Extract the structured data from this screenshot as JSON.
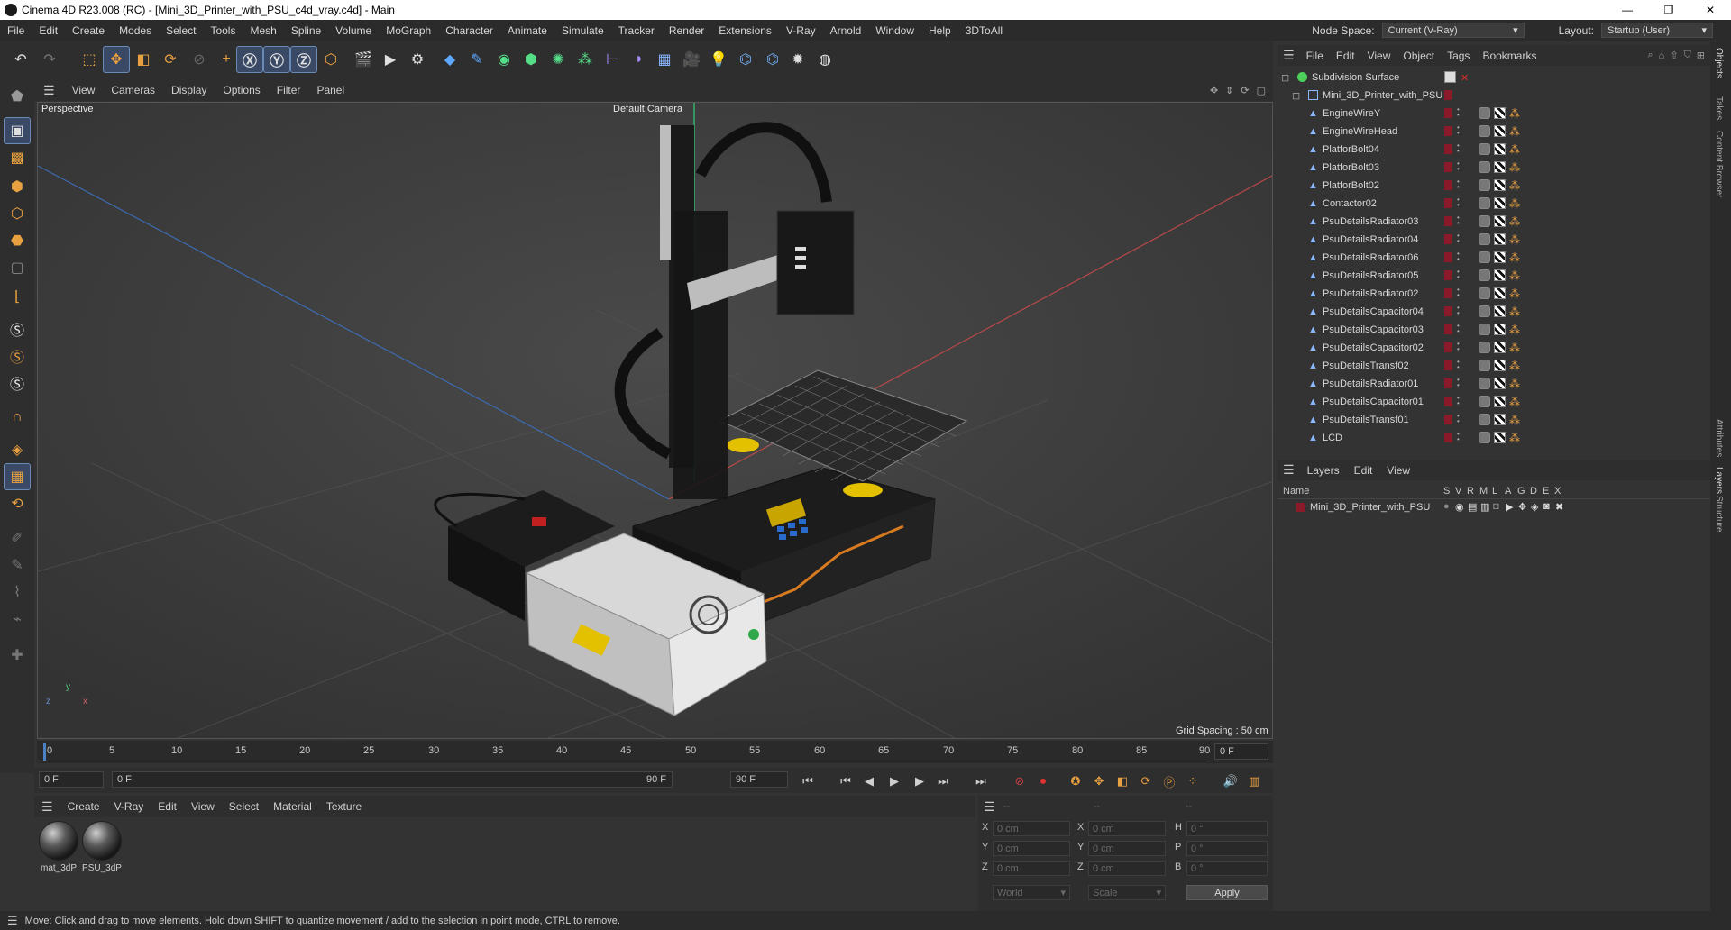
{
  "window": {
    "title": "Cinema 4D R23.008 (RC) - [Mini_3D_Printer_with_PSU_c4d_vray.c4d] - Main",
    "minimize": "—",
    "maximize": "❐",
    "close": "✕"
  },
  "menu": {
    "items": [
      "File",
      "Edit",
      "Create",
      "Modes",
      "Select",
      "Tools",
      "Mesh",
      "Spline",
      "Volume",
      "MoGraph",
      "Character",
      "Animate",
      "Simulate",
      "Tracker",
      "Render",
      "Extensions",
      "V-Ray",
      "Arnold",
      "Window",
      "Help",
      "3DToAll"
    ],
    "node_space_label": "Node Space:",
    "node_space_value": "Current (V-Ray)",
    "layout_label": "Layout:",
    "layout_value": "Startup (User)"
  },
  "viewport": {
    "menu": [
      "View",
      "Cameras",
      "Display",
      "Options",
      "Filter",
      "Panel"
    ],
    "view_name": "Perspective",
    "camera": "Default Camera",
    "grid_spacing": "Grid Spacing : 50 cm",
    "axis_y": "y",
    "axis_x": "x",
    "axis_z": "z"
  },
  "timeline": {
    "ticks": [
      "0",
      "5",
      "10",
      "15",
      "20",
      "25",
      "30",
      "35",
      "40",
      "45",
      "50",
      "55",
      "60",
      "65",
      "70",
      "75",
      "80",
      "85",
      "90"
    ],
    "current_frame": "0 F",
    "start_field": "0 F",
    "range_start": "0 F",
    "range_end": "90 F",
    "end_field": "90 F"
  },
  "materials": {
    "menu": [
      "Create",
      "V-Ray",
      "Edit",
      "View",
      "Select",
      "Material",
      "Texture"
    ],
    "items": [
      {
        "name": "mat_3dP"
      },
      {
        "name": "PSU_3dP"
      }
    ]
  },
  "coordinates": {
    "header_dashes": [
      "--",
      "--",
      "--"
    ],
    "rows": [
      {
        "a": "X",
        "av": "0 cm",
        "b": "X",
        "bv": "0 cm",
        "c": "H",
        "cv": "0 °"
      },
      {
        "a": "Y",
        "av": "0 cm",
        "b": "Y",
        "bv": "0 cm",
        "c": "P",
        "cv": "0 °"
      },
      {
        "a": "Z",
        "av": "0 cm",
        "b": "Z",
        "bv": "0 cm",
        "c": "B",
        "cv": "0 °"
      }
    ],
    "mode1": "World",
    "mode2": "Scale",
    "apply": "Apply"
  },
  "status": "Move: Click and drag to move elements. Hold down SHIFT to quantize movement / add to the selection in point mode, CTRL to remove.",
  "objects": {
    "menu": [
      "File",
      "Edit",
      "View",
      "Object",
      "Tags",
      "Bookmarks"
    ],
    "root": "Subdivision Surface",
    "group": "Mini_3D_Printer_with_PSU",
    "children": [
      "EngineWireY",
      "EngineWireHead",
      "PlatforBolt04",
      "PlatforBolt03",
      "PlatforBolt02",
      "Contactor02",
      "PsuDetailsRadiator03",
      "PsuDetailsRadiator04",
      "PsuDetailsRadiator06",
      "PsuDetailsRadiator05",
      "PsuDetailsRadiator02",
      "PsuDetailsCapacitor04",
      "PsuDetailsCapacitor03",
      "PsuDetailsCapacitor02",
      "PsuDetailsTransf02",
      "PsuDetailsRadiator01",
      "PsuDetailsCapacitor01",
      "PsuDetailsTransf01",
      "LCD"
    ]
  },
  "layers": {
    "menu": [
      "Layers",
      "Edit",
      "View"
    ],
    "columns": [
      "Name",
      "S",
      "V",
      "R",
      "M",
      "L",
      "A",
      "G",
      "D",
      "E",
      "X"
    ],
    "rows": [
      {
        "name": "Mini_3D_Printer_with_PSU"
      }
    ]
  },
  "side_tabs": [
    "Objects",
    "Takes",
    "Content Browser",
    "Attributes",
    "Layers",
    "Structure"
  ],
  "colors": {
    "accent": "#4d7fc4",
    "layer": "#8a1a2a",
    "ui_bg": "#333333"
  }
}
